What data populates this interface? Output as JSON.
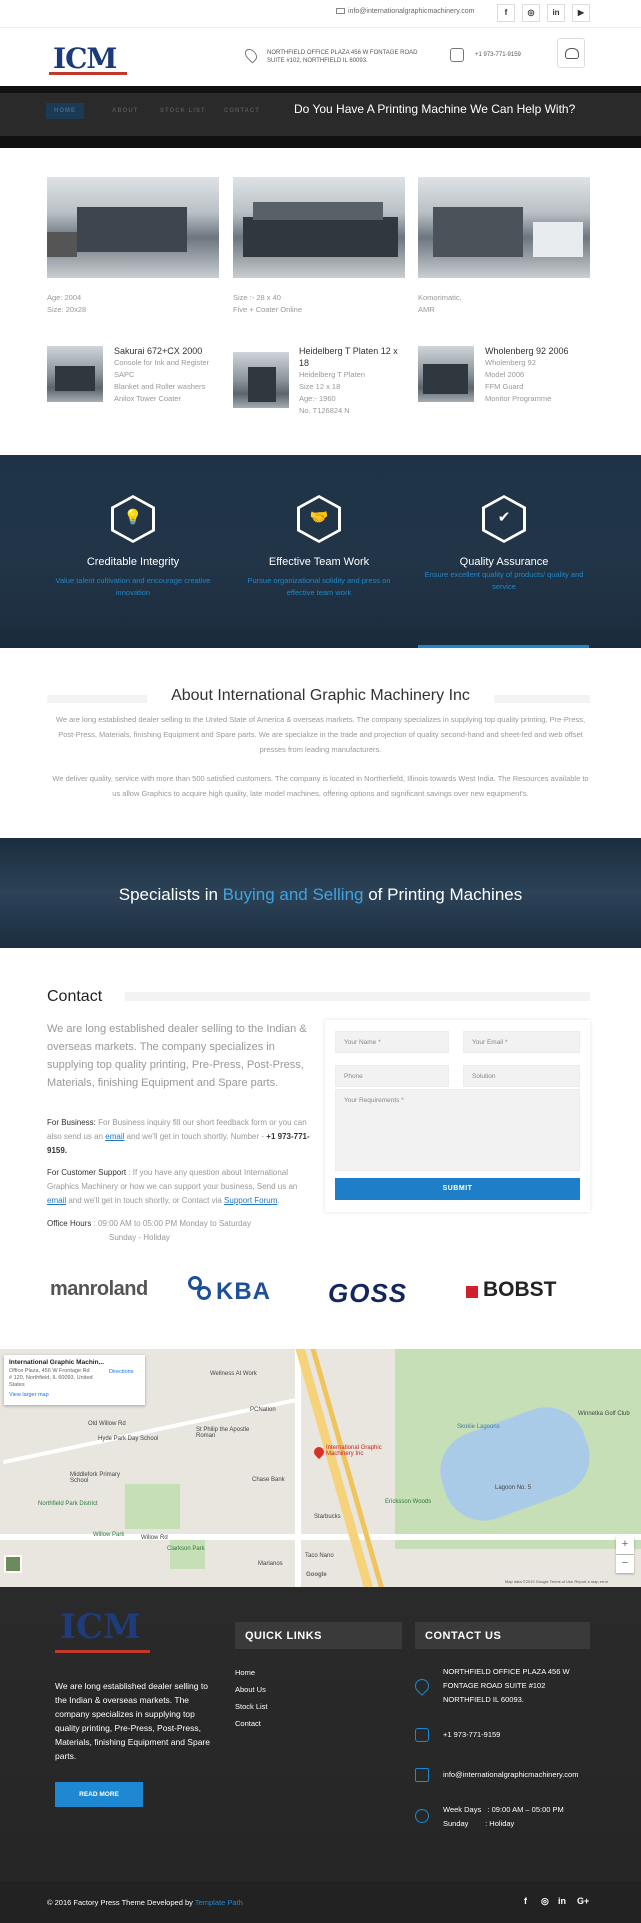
{
  "topbar": {
    "email": "info@internationalgraphicmachinery.com",
    "social": [
      {
        "icon": "facebook-icon",
        "glyph": "f"
      },
      {
        "icon": "instagram-icon",
        "glyph": "◎"
      },
      {
        "icon": "linkedin-icon",
        "glyph": "in"
      },
      {
        "icon": "youtube-icon",
        "glyph": "▶"
      }
    ]
  },
  "header": {
    "logo_text": "ICM",
    "address": "NORTHFIELD OFFICE PLAZA 456 W FONTAGE ROAD SUITE #102, NORTHFIELD IL 60093.",
    "phone": "+1 973-771-9159"
  },
  "nav": {
    "items": [
      "HOME",
      "ABOUT",
      "STOCK LIST",
      "CONTACT"
    ],
    "question": "Do You Have A Printing Machine We Can Help With?"
  },
  "products_top": [
    {
      "lines": [
        "Age: 2004",
        "Size: 20x28"
      ]
    },
    {
      "lines": [
        "Size :- 28 x 40",
        "Five + Coater Online"
      ]
    },
    {
      "lines": [
        "Komorimatic,",
        "AMR"
      ]
    }
  ],
  "products_bottom": [
    {
      "title": "Sakurai 672+CX 2000",
      "lines": [
        "Console for Ink and Register",
        "SAPC",
        "Blanket and Roller washers",
        "Anilox Tower Coater"
      ]
    },
    {
      "title": "Heidelberg T Platen 12 x 18",
      "lines": [
        "Heidelberg T Platen",
        "Size 12 x 18",
        "Age:- 1960",
        "No. T126824 N"
      ]
    },
    {
      "title": "Wholenberg 92 2006",
      "lines": [
        "Wholenberg 92",
        "Model 2006",
        "FFM Guard",
        "Monitor Programme"
      ]
    }
  ],
  "features": [
    {
      "title": "Creditable Integrity",
      "desc": "Value talent cultivation and encourage creative innovation",
      "icon": "lightbulb-icon",
      "glyph": "💡"
    },
    {
      "title": "Effective Team Work",
      "desc": "Pursue organizational solidity and press on effective team work",
      "icon": "handshake-icon",
      "glyph": "🤝"
    },
    {
      "title": "Quality Assurance",
      "desc": "Ensure excellent quality of products/ quality and service",
      "icon": "badge-icon",
      "glyph": "✔"
    }
  ],
  "about": {
    "title": "About International Graphic Machinery Inc",
    "p1": "We are long established dealer selling to the United State of America & overseas markets. The company specializes in supplying top quality printing, Pre-Press, Post-Press, Materials, finishing Equipment and Spare parts. We are specialize in the trade and projection of quality second-hand and sheet-fed and web offset presses from leading manufacturers.",
    "p2": "We deliver quality, service with more than 500 satisfied customers. The company is located in Northerfield, Illinois towards West India. The Resources available to us allow Graphics to acquire high quality, late model machines, offering options and significant savings over new equipment's."
  },
  "specialists": {
    "pre": "Specialists in ",
    "highlight": "Buying and Selling",
    "post": " of Printing Machines"
  },
  "contact": {
    "title": "Contact",
    "lead": "We are long established dealer selling to the Indian & overseas markets. The company specializes in supplying top quality printing, Pre-Press, Post-Press, Materials, finishing Equipment and Spare parts.",
    "business_label": "For Business:",
    "business_text1": " For Business inquiry fill our short feedback form or you can also send us an ",
    "business_link": "email",
    "business_text2": " and we'll get in touch shortly. Number - ",
    "business_number": "+1 973-771-9159.",
    "support_label": "For Customer Support",
    "support_text1": " : If you have any question about International Graphics Machinery or how we can support your business, Send us an ",
    "support_link1": "email",
    "support_text2": " and we'll get in touch shortly, or Contact via ",
    "support_link2": "Support Forum",
    "support_end": ".",
    "hours_label": "Office Hours",
    "hours_line1": " : 09:00 AM to 05:00 PM Monday to Saturday",
    "hours_line2": "Sunday - Holiday",
    "form": {
      "name": "Your Name *",
      "email": "Your Email *",
      "phone": "Phone",
      "solution": "Solution",
      "requirements": "Your Requirements *",
      "submit": "SUBMIT"
    }
  },
  "brands": [
    "manroland",
    "KBA",
    "GOSS",
    "BOBST"
  ],
  "map": {
    "place": "International Graphic Machin...",
    "address": "Office Plaza, 456 W Frontage Rd # 120, Northfield, IL 60093, United States",
    "directions": "Directions",
    "larger": "View larger map",
    "pin_label": "International Graphic Machinery Inc",
    "labels": [
      "Wellness At Work",
      "Old Willow Rd",
      "Hyde Park Day School",
      "St Philip the Apostle Roman",
      "Middlefork Primary School",
      "Northfield Park District",
      "Willow Park",
      "Clarkson Park",
      "Chase Bank",
      "Starbucks",
      "Ericksson Woods",
      "Lagoon No. 5",
      "Winnetka Golf Club",
      "Skokie Lagoons",
      "Willow Rd",
      "Google",
      "Marianos",
      "Taco Nano",
      "PCNation"
    ],
    "attribution": "Map data ©2019 Google   Terms of Use   Report a map error"
  },
  "footer": {
    "logo_text": "ICM",
    "about": "We are long established dealer selling to the Indian & overseas markets. The company specializes in supplying top quality printing, Pre-Press, Post-Press, Materials, finishing Equipment and Spare parts.",
    "read_more": "READ MORE",
    "quick_links_title": "QUICK LINKS",
    "quick_links": [
      "Home",
      "About Us",
      "Stock List",
      "Contact"
    ],
    "contact_title": "CONTACT US",
    "address": "NORTHFIELD OFFICE PLAZA 456 W FONTAGE ROAD SUITE #102 NORTHFIELD IL 60093.",
    "phone": "+1 973-771-9159",
    "email": "info@internationalgraphicmachinery.com",
    "hours1": "Week Days   : 09:00 AM – 05:00 PM",
    "hours2": "Sunday        : Holiday",
    "copyright_pre": "© 2016 Factory Press Theme Developed by ",
    "copyright_link": "Template Path",
    "social": [
      "f",
      "◎",
      "in",
      "G+"
    ]
  },
  "colors": {
    "accent": "#1e88d2",
    "dark": "#222222",
    "feature_bg": "#223548"
  }
}
